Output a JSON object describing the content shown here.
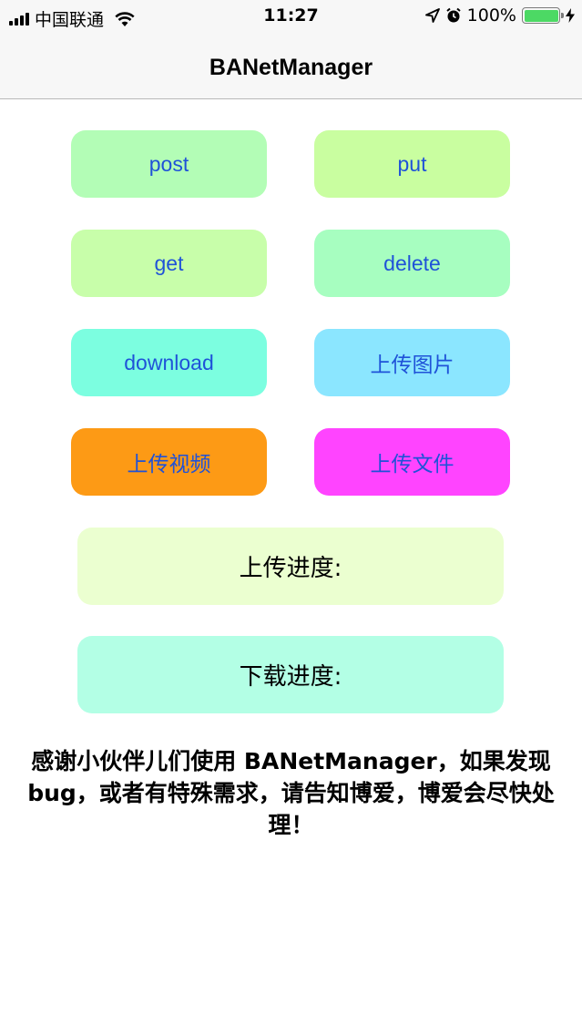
{
  "status_bar": {
    "carrier": "中国联通",
    "time": "11:27",
    "battery_text": "100%",
    "battery_level": 1.0
  },
  "nav": {
    "title": "BANetManager"
  },
  "buttons": {
    "post": "post",
    "put": "put",
    "get": "get",
    "delete": "delete",
    "download": "download",
    "upload_image": "上传图片",
    "upload_video": "上传视频",
    "upload_file": "上传文件"
  },
  "colors": {
    "post": "#b3fdb6",
    "put": "#c9fea0",
    "get": "#c8feaa",
    "delete": "#a7fec0",
    "download": "#7cfee0",
    "upload_image": "#8be6ff",
    "upload_video": "#fd9a15",
    "upload_file": "#ff44ff",
    "upload_progress": "#ebffd0",
    "download_progress": "#b3ffe5",
    "button_text": "#1f52d8"
  },
  "progress": {
    "upload_label": "上传进度:",
    "download_label": "下载进度:"
  },
  "footer": {
    "message": "感谢小伙伴儿们使用 BANetManager，如果发现 bug，或者有特殊需求，请告知博爱，博爱会尽快处理！"
  }
}
